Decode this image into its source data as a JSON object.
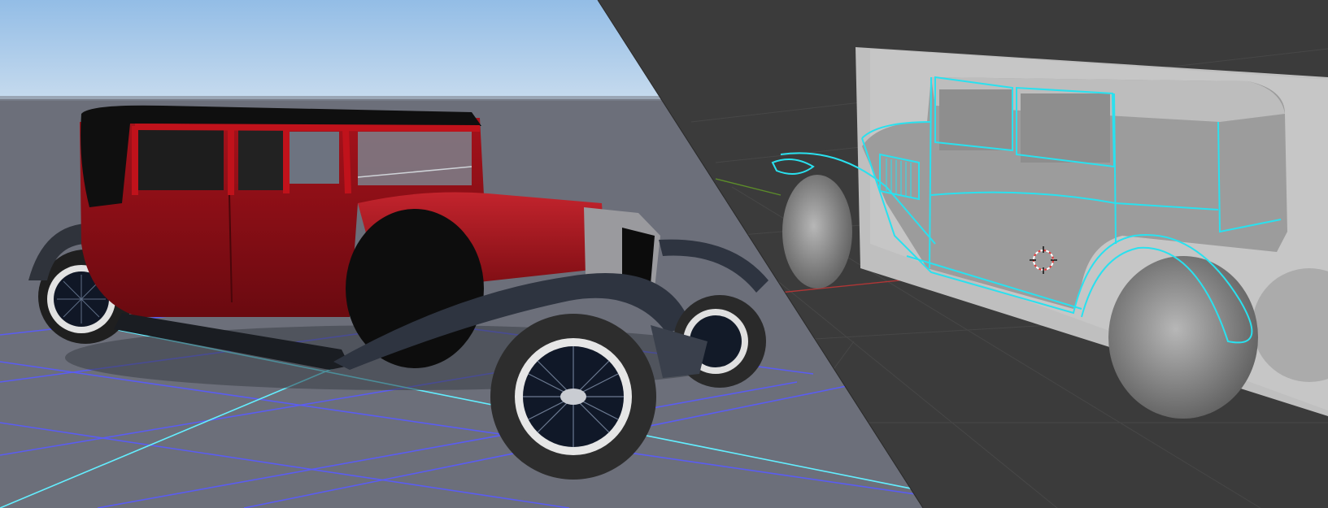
{
  "image": {
    "description_free": true,
    "panels": [
      {
        "name": "rendered-preview",
        "style": "shaded render"
      },
      {
        "name": "modeling-viewport",
        "style": "wireframe + reference image"
      }
    ]
  },
  "colors": {
    "sky_top": "#9ec3e6",
    "sky_bottom": "#c9ddf0",
    "ground_left": "#6e717c",
    "grid_blue": "#5b5cf0",
    "grid_cyan": "#65f0ff",
    "viewport_bg": "#3a3a3a",
    "viewport_grid": "#474747",
    "axis_red": "#b03a3a",
    "axis_green": "#5a8f2a",
    "car_red": "#8c0f16",
    "car_red_light": "#b0141e",
    "roof_black": "#111111",
    "fender_gray": "#3a3f48",
    "tire_black": "#2a2a2a",
    "rim_white": "#e6e6e6",
    "wire_cyan": "#27e0ee",
    "model_gray": "#9a9a9a",
    "reference_bg": "#bdbdbd"
  }
}
